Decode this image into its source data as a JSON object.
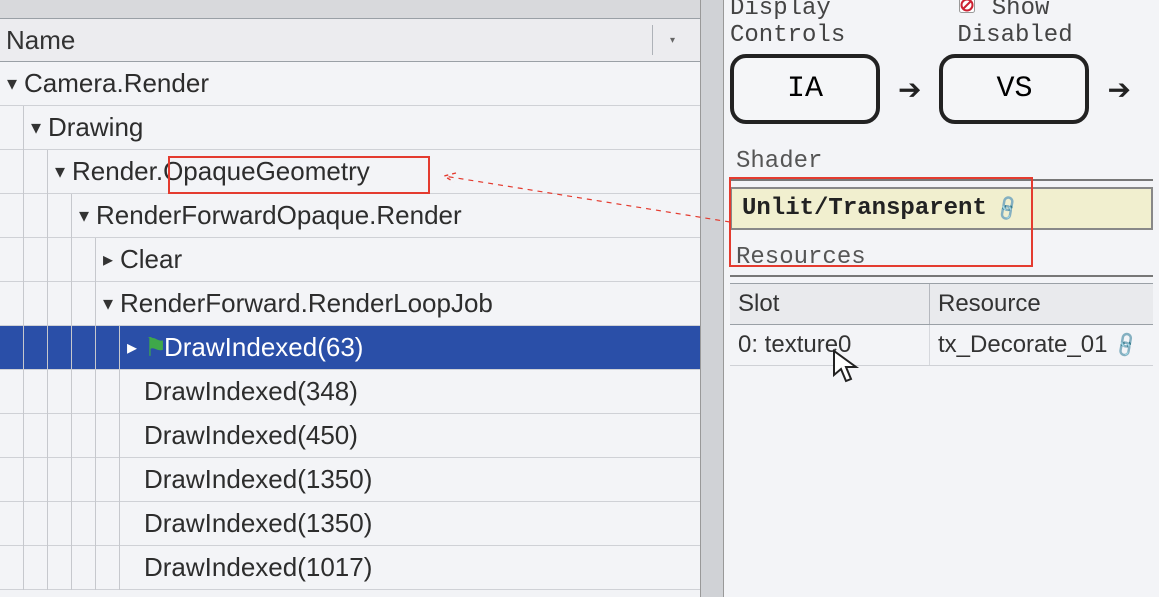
{
  "left": {
    "column_header": "Name",
    "tree": [
      {
        "depth": 0,
        "expanded": true,
        "label": "Camera.Render"
      },
      {
        "depth": 1,
        "expanded": true,
        "label": "Drawing"
      },
      {
        "depth": 2,
        "expanded": true,
        "label": "Render.OpaqueGeometry",
        "highlighted": true
      },
      {
        "depth": 3,
        "expanded": true,
        "label": "RenderForwardOpaque.Render"
      },
      {
        "depth": 4,
        "expanded": false,
        "label": "Clear"
      },
      {
        "depth": 4,
        "expanded": true,
        "label": "RenderForward.RenderLoopJob"
      },
      {
        "depth": 5,
        "selected": true,
        "flag": true,
        "label": "DrawIndexed(63)"
      },
      {
        "depth": 5,
        "leaf": true,
        "label": "DrawIndexed(348)"
      },
      {
        "depth": 5,
        "leaf": true,
        "label": "DrawIndexed(450)"
      },
      {
        "depth": 5,
        "leaf": true,
        "label": "DrawIndexed(1350)"
      },
      {
        "depth": 5,
        "leaf": true,
        "label": "DrawIndexed(1350)"
      },
      {
        "depth": 5,
        "leaf": true,
        "label": "DrawIndexed(1017)"
      }
    ]
  },
  "right": {
    "breadcrumb": {
      "display_controls": "Display Controls",
      "show_disabled": "Show Disabled"
    },
    "pipeline": {
      "stage1": "IA",
      "stage2": "VS"
    },
    "shader_label": "Shader",
    "shader_value": "Unlit/Transparent",
    "resources_label": "Resources",
    "resources_columns": {
      "slot": "Slot",
      "resource": "Resource"
    },
    "resources_rows": [
      {
        "slot": "0: texture0",
        "resource": "tx_Decorate_01"
      }
    ]
  }
}
